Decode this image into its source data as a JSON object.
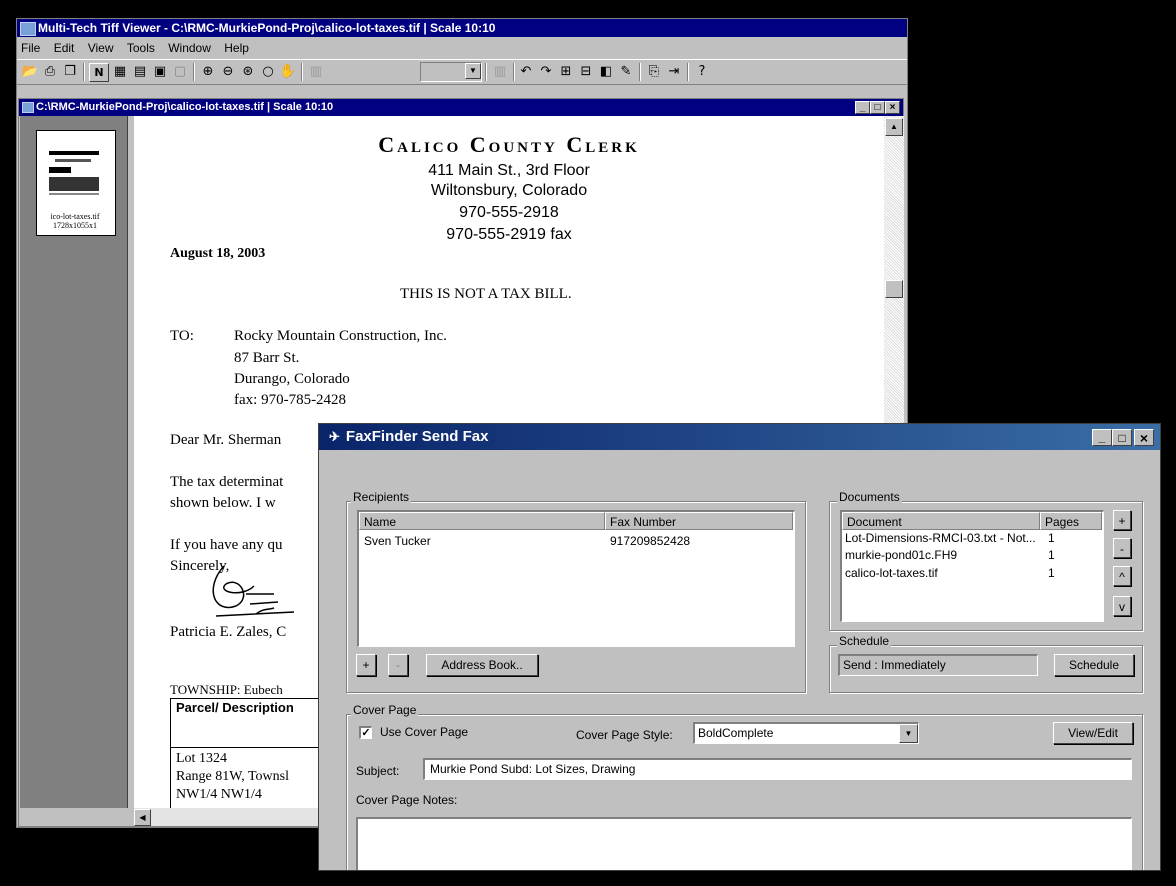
{
  "tiff_app": {
    "title": "Multi-Tech Tiff Viewer - C:\\RMC-MurkiePond-Proj\\calico-lot-taxes.tif | Scale 10:10",
    "menu": [
      "File",
      "Edit",
      "View",
      "Tools",
      "Window",
      "Help"
    ]
  },
  "doc_window": {
    "title": "C:\\RMC-MurkiePond-Proj\\calico-lot-taxes.tif | Scale 10:10",
    "thumb_label_1": "ico-lot-taxes.tif",
    "thumb_label_2": "1728x1055x1"
  },
  "letter": {
    "org": "Calico County Clerk",
    "address1": "411 Main St., 3rd Floor",
    "address2": "Wiltonsbury, Colorado",
    "phone": "970-555-2918",
    "fax": "970-555-2919 fax",
    "date": "August 18, 2003",
    "notice": "THIS IS NOT A TAX BILL.",
    "to_label": "TO:",
    "to_name": "Rocky Mountain Construction, Inc.",
    "to_street": "87 Barr St.",
    "to_city": "Durango, Colorado",
    "to_fax": "fax: 970-785-2428",
    "greeting": "Dear Mr. Sherman",
    "body1": "The tax determinat",
    "body2": "shown below.  I w",
    "body3": "If you have any qu",
    "closing": "Sincerely,",
    "signer": "Patricia E. Zales, C",
    "township": "TOWNSHIP:  Eubech",
    "table_header": "Parcel/ Description",
    "lot": "Lot 1324",
    "range": "Range 81W, Townsl",
    "nw": "NW1/4 NW1/4"
  },
  "fax_dialog": {
    "title": "FaxFinder Send Fax",
    "recipients_label": "Recipients",
    "recipients_columns": [
      "Name",
      "Fax Number"
    ],
    "recipients": [
      {
        "name": "Sven Tucker",
        "fax": "917209852428"
      }
    ],
    "add_label": "+",
    "remove_label": "-",
    "address_book_label": "Address Book..",
    "documents_label": "Documents",
    "documents_columns": [
      "Document",
      "Pages"
    ],
    "documents": [
      {
        "name": "Lot-Dimensions-RMCI-03.txt - Not...",
        "pages": "1"
      },
      {
        "name": "murkie-pond01c.FH9",
        "pages": "1"
      },
      {
        "name": "calico-lot-taxes.tif",
        "pages": "1"
      }
    ],
    "doc_buttons": [
      "+",
      "-",
      "^",
      "v"
    ],
    "schedule_label": "Schedule",
    "schedule_value": "Send : Immediately",
    "schedule_button": "Schedule",
    "cover_label": "Cover Page",
    "use_cover_label": "Use Cover Page",
    "use_cover_checked": true,
    "cover_style_label": "Cover Page Style:",
    "cover_style_value": "BoldComplete",
    "view_edit_label": "View/Edit",
    "subject_label": "Subject:",
    "subject_value": "Murkie Pond Subd: Lot Sizes, Drawing",
    "notes_label": "Cover Page Notes:"
  }
}
